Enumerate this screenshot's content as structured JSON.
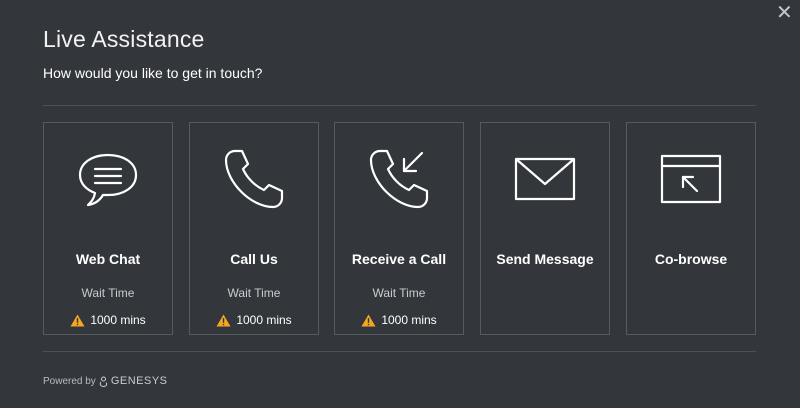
{
  "dialog": {
    "title": "Live Assistance",
    "subtitle": "How would you like to get in touch?",
    "close_label": "✕"
  },
  "cards": [
    {
      "label": "Web Chat",
      "icon": "chat-bubble-icon",
      "wait_label": "Wait Time",
      "wait_value": "1000 mins"
    },
    {
      "label": "Call Us",
      "icon": "phone-icon",
      "wait_label": "Wait Time",
      "wait_value": "1000 mins"
    },
    {
      "label": "Receive a Call",
      "icon": "phone-incoming-icon",
      "wait_label": "Wait Time",
      "wait_value": "1000 mins"
    },
    {
      "label": "Send Message",
      "icon": "envelope-icon"
    },
    {
      "label": "Co-browse",
      "icon": "browser-pointer-icon"
    }
  ],
  "footer": {
    "powered_by": "Powered by",
    "brand": "GENESYS"
  },
  "colors": {
    "background": "#33373b",
    "card_border": "#565b60",
    "warning": "#f5a623"
  }
}
